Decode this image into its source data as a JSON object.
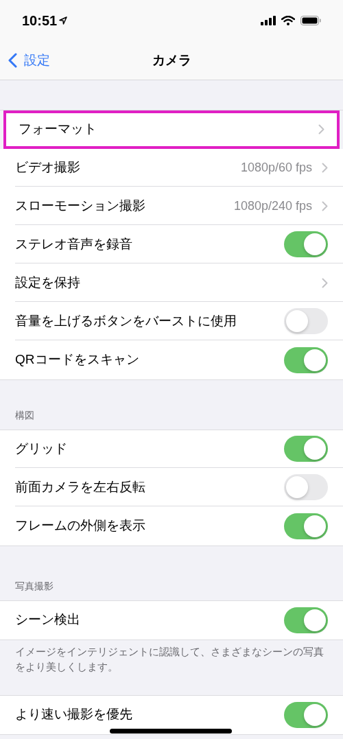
{
  "status_bar": {
    "time": "10:51"
  },
  "nav": {
    "back": "設定",
    "title": "カメラ"
  },
  "sections": [
    {
      "rows": [
        {
          "kind": "chevron",
          "label": "フォーマット",
          "highlighted": true
        },
        {
          "kind": "chevron",
          "label": "ビデオ撮影",
          "value": "1080p/60 fps",
          "highlighted": false
        },
        {
          "kind": "chevron",
          "label": "スローモーション撮影",
          "value": "1080p/240 fps",
          "highlighted": false
        },
        {
          "kind": "toggle",
          "label": "ステレオ音声を録音",
          "on": true
        },
        {
          "kind": "chevron",
          "label": "設定を保持",
          "highlighted": false
        },
        {
          "kind": "toggle",
          "label": "音量を上げるボタンをバーストに使用",
          "on": false
        },
        {
          "kind": "toggle",
          "label": "QRコードをスキャン",
          "on": true
        }
      ]
    },
    {
      "header": "構図",
      "rows": [
        {
          "kind": "toggle",
          "label": "グリッド",
          "on": true
        },
        {
          "kind": "toggle",
          "label": "前面カメラを左右反転",
          "on": false
        },
        {
          "kind": "toggle",
          "label": "フレームの外側を表示",
          "on": true
        }
      ]
    },
    {
      "header": "写真撮影",
      "rows": [
        {
          "kind": "toggle",
          "label": "シーン検出",
          "on": true
        }
      ],
      "footer": "イメージをインテリジェントに認識して、さまざまなシーンの写真をより美しくします。"
    },
    {
      "rows": [
        {
          "kind": "toggle",
          "label": "より速い撮影を優先",
          "on": true
        }
      ]
    }
  ]
}
